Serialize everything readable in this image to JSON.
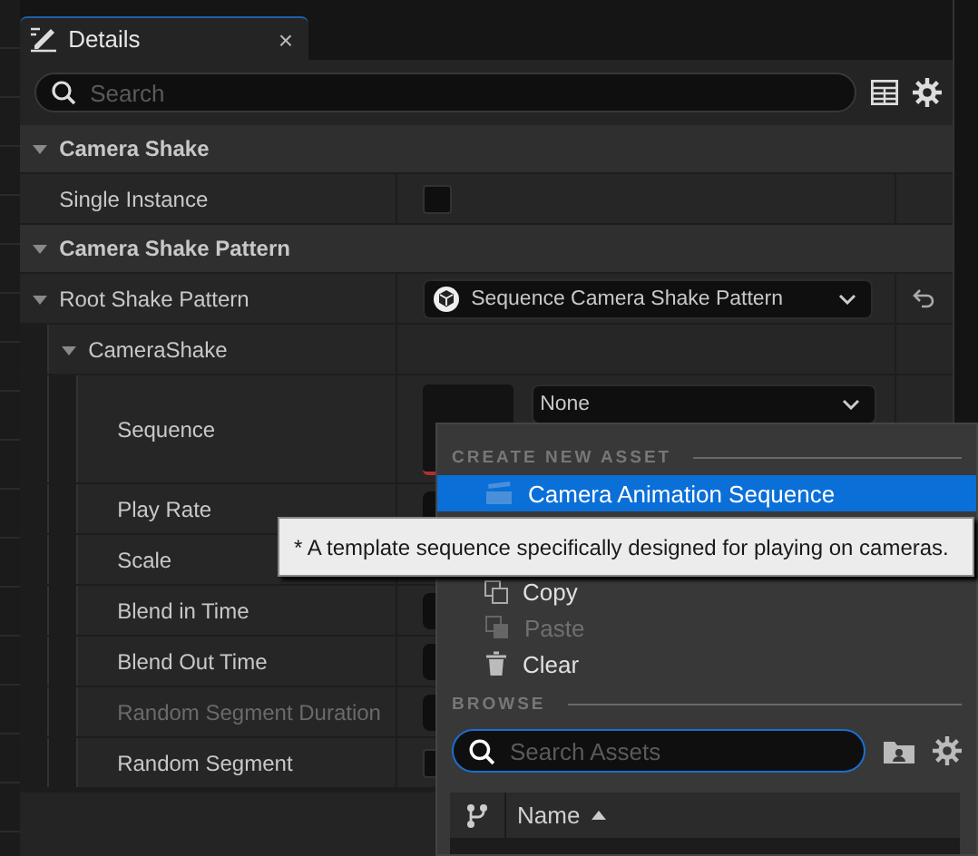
{
  "tab": {
    "title": "Details",
    "close": "×"
  },
  "search": {
    "placeholder": "Search"
  },
  "sections": [
    {
      "title": "Camera Shake",
      "expanded": true,
      "rows": [
        {
          "label": "Single Instance",
          "kind": "checkbox",
          "checked": false,
          "reset": false
        }
      ]
    },
    {
      "title": "Camera Shake Pattern",
      "expanded": true,
      "rows": [
        {
          "label": "Root Shake Pattern",
          "kind": "class-picker",
          "value": "Sequence Camera Shake Pattern",
          "expanded": true,
          "reset": true,
          "children": [
            {
              "label": "CameraShake",
              "expanded": true,
              "reset": false,
              "children": [
                {
                  "label": "Sequence",
                  "kind": "asset",
                  "value": "None"
                },
                {
                  "label": "Play Rate",
                  "kind": "number"
                },
                {
                  "label": "Scale",
                  "kind": "number"
                },
                {
                  "label": "Blend in Time",
                  "kind": "number"
                },
                {
                  "label": "Blend Out Time",
                  "kind": "number"
                },
                {
                  "label": "Random Segment Duration",
                  "kind": "number",
                  "disabled": true
                },
                {
                  "label": "Random Segment",
                  "kind": "checkbox",
                  "checked": false
                }
              ]
            }
          ]
        }
      ]
    }
  ],
  "menu": {
    "create_title": "CREATE NEW ASSET",
    "items": [
      {
        "label": "Camera Animation Sequence",
        "kind": "create",
        "selected": true,
        "disabled": false
      },
      {
        "label": "Copy",
        "kind": "copy",
        "selected": false,
        "disabled": false
      },
      {
        "label": "Paste",
        "kind": "paste",
        "selected": false,
        "disabled": true
      },
      {
        "label": "Clear",
        "kind": "clear",
        "selected": false,
        "disabled": false
      }
    ],
    "browse_title": "BROWSE",
    "asset_search": {
      "placeholder": "Search Assets"
    },
    "columns": [
      {
        "label": "Name",
        "sorted": true
      }
    ]
  },
  "tooltip": {
    "text": "* A template sequence specifically designed for playing on cameras."
  }
}
